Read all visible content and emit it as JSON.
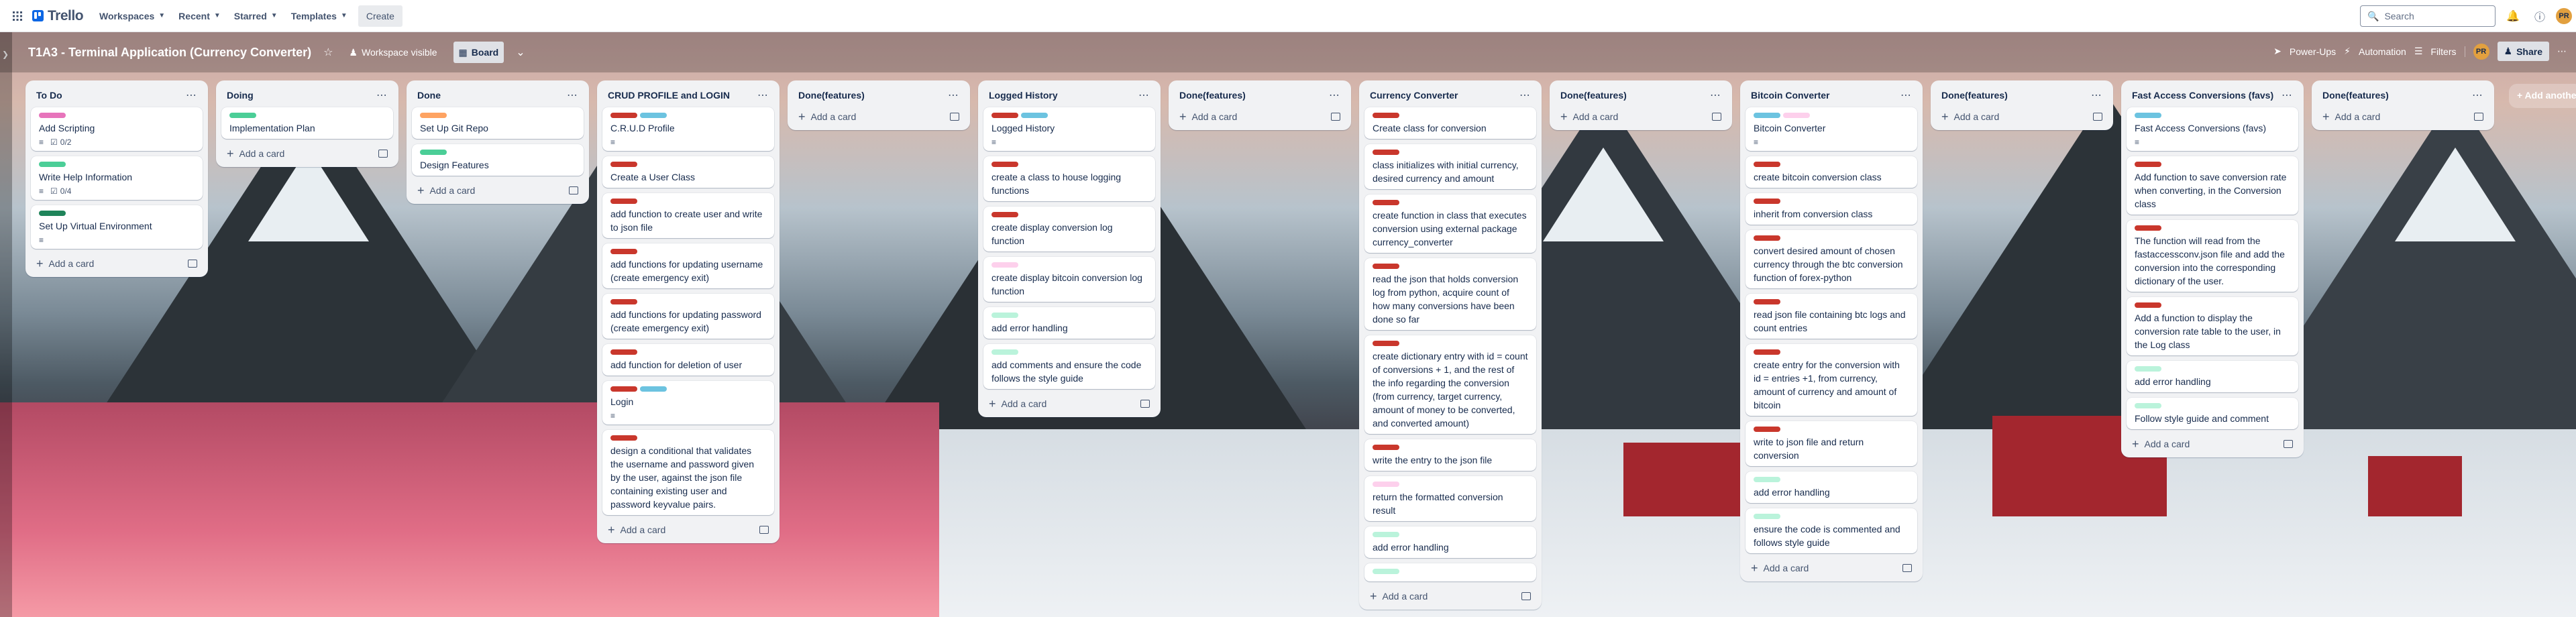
{
  "nav": {
    "logo": "Trello",
    "items": [
      {
        "label": "Workspaces"
      },
      {
        "label": "Recent"
      },
      {
        "label": "Starred"
      },
      {
        "label": "Templates"
      }
    ],
    "create_label": "Create",
    "search_placeholder": "Search",
    "avatar_initials": "PR"
  },
  "board": {
    "title": "T1A3 - Terminal Application (Currency Converter)",
    "visibility": "Workspace visible",
    "view": "Board",
    "powerups": "Power-Ups",
    "automation": "Automation",
    "filters": "Filters",
    "member_initials": "PR",
    "share": "Share",
    "add_list": "Add another list"
  },
  "colors": {
    "pink": "#e774bb",
    "green": "#4bce97",
    "darkgreen": "#1f845a",
    "orange": "#fea362",
    "red": "#c9372c",
    "lightgreen": "#baf3db",
    "lightpink": "#fdd0ec",
    "blue": "#6cc3e0",
    "skyblue": "#6cc3e0",
    "lightblue": "#9dd9ee"
  },
  "lists": [
    {
      "title": "To Do",
      "add_label": "Add a card",
      "cards": [
        {
          "text": "Add Scripting",
          "labels": [
            "pink"
          ],
          "desc": true,
          "checklist": "0/2"
        },
        {
          "text": "Write Help Information",
          "labels": [
            "green"
          ],
          "desc": true,
          "checklist": "0/4"
        },
        {
          "text": "Set Up Virtual Environment",
          "labels": [
            "darkgreen"
          ],
          "desc": true
        }
      ]
    },
    {
      "title": "Doing",
      "add_label": "Add a card",
      "cards": [
        {
          "text": "Implementation Plan",
          "labels": [
            "green"
          ]
        }
      ]
    },
    {
      "title": "Done",
      "add_label": "Add a card",
      "cards": [
        {
          "text": "Set Up Git Repo",
          "labels": [
            "orange"
          ]
        },
        {
          "text": "Design Features",
          "labels": [
            "green"
          ]
        }
      ]
    },
    {
      "title": "CRUD PROFILE and LOGIN",
      "add_label": "Add a card",
      "cards": [
        {
          "text": "C.R.U.D Profile",
          "labels": [
            "red",
            "blue"
          ],
          "desc": true
        },
        {
          "text": "Create a User Class",
          "labels": [
            "red"
          ]
        },
        {
          "text": "add function to create user and write to json file",
          "labels": [
            "red"
          ]
        },
        {
          "text": "add functions for updating username (create emergency exit)",
          "labels": [
            "red"
          ]
        },
        {
          "text": "add functions for updating password (create emergency exit)",
          "labels": [
            "red"
          ]
        },
        {
          "text": "add function for deletion of user",
          "labels": [
            "red"
          ]
        },
        {
          "text": "Login",
          "labels": [
            "red",
            "blue"
          ],
          "desc": true
        },
        {
          "text": "design a conditional that validates the username and password given by the user, against the json file containing existing user and password keyvalue pairs.",
          "labels": [
            "red"
          ]
        }
      ]
    },
    {
      "title": "Done(features)",
      "add_label": "Add a card",
      "cards": []
    },
    {
      "title": "Logged History",
      "add_label": "Add a card",
      "cards": [
        {
          "text": "Logged History",
          "labels": [
            "red",
            "blue"
          ],
          "desc": true
        },
        {
          "text": "create a class to house logging functions",
          "labels": [
            "red"
          ]
        },
        {
          "text": "create display conversion log function",
          "labels": [
            "red"
          ]
        },
        {
          "text": "create display bitcoin conversion log function",
          "labels": [
            "lightpink"
          ]
        },
        {
          "text": "add error handling",
          "labels": [
            "lightgreen"
          ]
        },
        {
          "text": "add comments and ensure the code follows the style guide",
          "labels": [
            "lightgreen"
          ]
        }
      ]
    },
    {
      "title": "Done(features)",
      "add_label": "Add a card",
      "cards": []
    },
    {
      "title": "Currency Converter",
      "add_label": "Add a card",
      "cards": [
        {
          "text": "Create class for conversion",
          "labels": [
            "red"
          ]
        },
        {
          "text": "class initializes with initial currency, desired currency and amount",
          "labels": [
            "red"
          ]
        },
        {
          "text": "create function in class that executes conversion using external package currency_converter",
          "labels": [
            "red"
          ]
        },
        {
          "text": "read the json that holds conversion log from python, acquire count of how many conversions have been done so far",
          "labels": [
            "red"
          ]
        },
        {
          "text": "create dictionary entry with id = count of conversions + 1, and the rest of the info regarding the conversion (from currency, target currency, amount of money to be converted, and converted amount)",
          "labels": [
            "red"
          ]
        },
        {
          "text": "write the entry to the json file",
          "labels": [
            "red"
          ]
        },
        {
          "text": "return the formatted conversion result",
          "labels": [
            "lightpink"
          ]
        },
        {
          "text": "add error handling",
          "labels": [
            "lightgreen"
          ]
        },
        {
          "text": "",
          "labels": [
            "lightgreen"
          ]
        }
      ]
    },
    {
      "title": "Done(features)",
      "add_label": "Add a card",
      "cards": []
    },
    {
      "title": "Bitcoin Converter",
      "add_label": "Add a card",
      "cards": [
        {
          "text": "Bitcoin Converter",
          "labels": [
            "blue",
            "lightpink"
          ],
          "desc": true
        },
        {
          "text": "create bitcoin conversion class",
          "labels": [
            "red"
          ]
        },
        {
          "text": "inherit from conversion class",
          "labels": [
            "red"
          ]
        },
        {
          "text": "convert desired amount of chosen currency through the btc conversion function of forex-python",
          "labels": [
            "red"
          ]
        },
        {
          "text": "read json file containing btc logs and count entries",
          "labels": [
            "red"
          ]
        },
        {
          "text": "create entry for the conversion with id = entries +1, from currency, amount of currency and amount of bitcoin",
          "labels": [
            "red"
          ]
        },
        {
          "text": "write to json file and return conversion",
          "labels": [
            "red"
          ]
        },
        {
          "text": "add error handling",
          "labels": [
            "lightgreen"
          ]
        },
        {
          "text": "ensure the code is commented and follows style guide",
          "labels": [
            "lightgreen"
          ]
        }
      ]
    },
    {
      "title": "Done(features)",
      "add_label": "Add a card",
      "cards": []
    },
    {
      "title": "Fast Access Conversions (favs)",
      "add_label": "Add a card",
      "cards": [
        {
          "text": "Fast Access Conversions (favs)",
          "labels": [
            "blue"
          ],
          "desc": true
        },
        {
          "text": "Add function to save conversion rate when converting, in the Conversion class",
          "labels": [
            "red"
          ]
        },
        {
          "text": "The function will read from the fastaccessconv.json file and add the conversion into the corresponding dictionary of the user.",
          "labels": [
            "red"
          ]
        },
        {
          "text": "Add a function to display the conversion rate table to the user, in the Log class",
          "labels": [
            "red"
          ]
        },
        {
          "text": "add error handling",
          "labels": [
            "lightgreen"
          ]
        },
        {
          "text": "Follow style guide and comment",
          "labels": [
            "lightgreen"
          ]
        }
      ]
    },
    {
      "title": "Done(features)",
      "add_label": "Add a card",
      "cards": []
    }
  ]
}
